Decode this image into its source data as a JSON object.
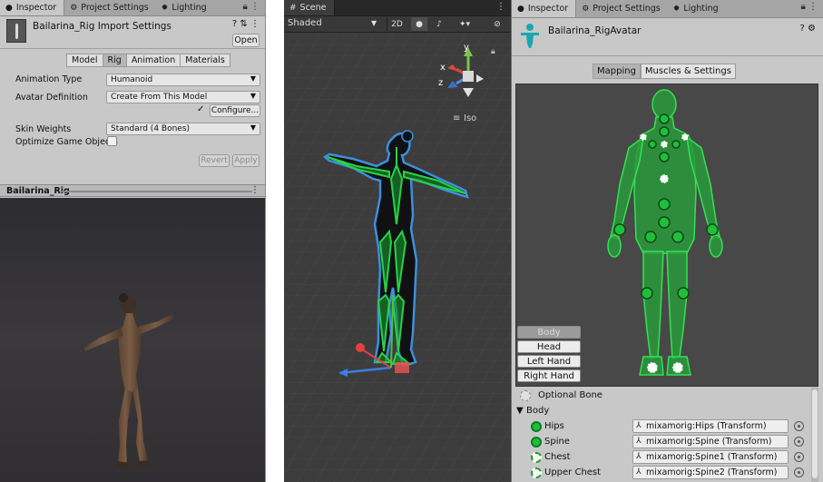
{
  "left": {
    "tabs": [
      {
        "icon": "●",
        "label": "Inspector"
      },
      {
        "icon": "⚙",
        "label": "Project Settings"
      },
      {
        "icon": "✹",
        "label": "Lighting"
      }
    ],
    "header": {
      "title": "Bailarina_Rig Import Settings",
      "open_label": "Open"
    },
    "subtabs": [
      "Model",
      "Rig",
      "Animation",
      "Materials"
    ],
    "rows": {
      "animation_type": {
        "label": "Animation Type",
        "value": "Humanoid"
      },
      "avatar_definition": {
        "label": "Avatar Definition",
        "value": "Create From This Model"
      },
      "configure_label": "Configure...",
      "skin_weights": {
        "label": "Skin Weights",
        "value": "Standard (4 Bones)"
      },
      "optimize_label": "Optimize Game Objects"
    },
    "revert_label": "Revert",
    "apply_label": "Apply",
    "preview_title": "Bailarina_Rig"
  },
  "scene": {
    "tab": "Scene",
    "shading": "Shaded",
    "toggle_2d": "2D",
    "iso_label": "Iso",
    "gizmo": {
      "x": "x",
      "y": "y",
      "z": "z"
    }
  },
  "right": {
    "tabs": [
      {
        "icon": "●",
        "label": "Inspector"
      },
      {
        "icon": "⚙",
        "label": "Project Settings"
      },
      {
        "icon": "✹",
        "label": "Lighting"
      }
    ],
    "title": "Bailarina_RigAvatar",
    "mapping_tabs": [
      "Mapping",
      "Muscles & Settings"
    ],
    "body_buttons": [
      "Body",
      "Head",
      "Left Hand",
      "Right Hand"
    ],
    "optional_bone": "Optional Bone",
    "body_group": "Body",
    "bones": [
      {
        "name": "Hips",
        "value": "mixamorig:Hips (Transform)",
        "style": "solid"
      },
      {
        "name": "Spine",
        "value": "mixamorig:Spine (Transform)",
        "style": "solid"
      },
      {
        "name": "Chest",
        "value": "mixamorig:Spine1 (Transform)",
        "style": "dashed"
      },
      {
        "name": "Upper Chest",
        "value": "mixamorig:Spine2 (Transform)",
        "style": "dashed"
      }
    ],
    "mapped_color": "#1fbf3b"
  }
}
